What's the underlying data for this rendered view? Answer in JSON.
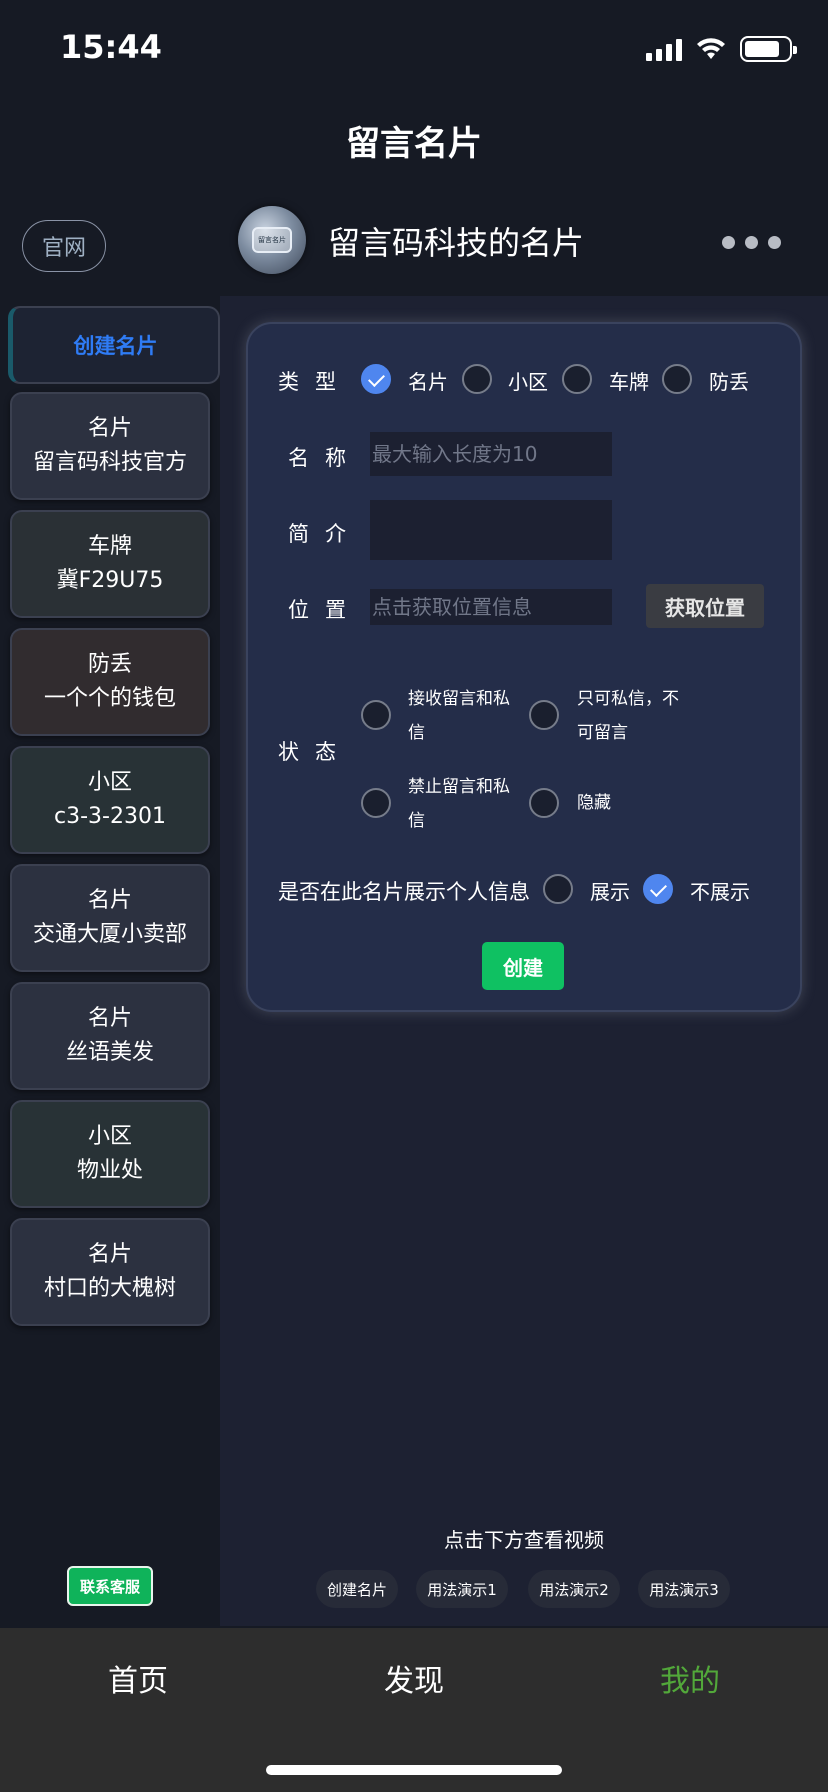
{
  "status_bar": {
    "time": "15:44"
  },
  "nav": {
    "title": "留言名片"
  },
  "header": {
    "site_label": "官网",
    "avatar_text": "留言名片",
    "title": "留言码科技的名片"
  },
  "sidebar": {
    "active_label": "创建名片",
    "items": [
      {
        "type": "名片",
        "name": "留言码科技官方"
      },
      {
        "type": "车牌",
        "name": "冀F29U75"
      },
      {
        "type": "防丢",
        "name": "一个个的钱包"
      },
      {
        "type": "小区",
        "name": "c3-3-2301"
      },
      {
        "type": "名片",
        "name": "交通大厦小卖部"
      },
      {
        "type": "名片",
        "name": "丝语美发"
      },
      {
        "type": "小区",
        "name": "物业处"
      },
      {
        "type": "名片",
        "name": "村口的大槐树"
      }
    ],
    "contact_label": "联系客服"
  },
  "form": {
    "type_label": "类型",
    "type_options": [
      "名片",
      "小区",
      "车牌",
      "防丢"
    ],
    "type_selected": "名片",
    "name_label": "名称",
    "name_placeholder": "最大输入长度为10",
    "intro_label": "简介",
    "location_label": "位置",
    "location_placeholder": "点击获取位置信息",
    "locate_button": "获取位置",
    "status_label": "状态",
    "status_options": {
      "opt1_line1": "接收留言和私",
      "opt1_line2": "信",
      "opt2_line1": "只可私信，不",
      "opt2_line2": "可留言",
      "opt3_line1": "禁止留言和私",
      "opt3_line2": "信",
      "opt4": "隐藏"
    },
    "show_info_label": "是否在此名片展示个人信息",
    "show_option": "展示",
    "hide_option": "不展示",
    "show_selected": "不展示",
    "create_button": "创建"
  },
  "video": {
    "hint": "点击下方查看视频",
    "tabs": [
      "创建名片",
      "用法演示1",
      "用法演示2",
      "用法演示3"
    ]
  },
  "tabbar": {
    "items": [
      "首页",
      "发现",
      "我的"
    ],
    "active": "我的",
    "active_color": "#52a83a"
  }
}
